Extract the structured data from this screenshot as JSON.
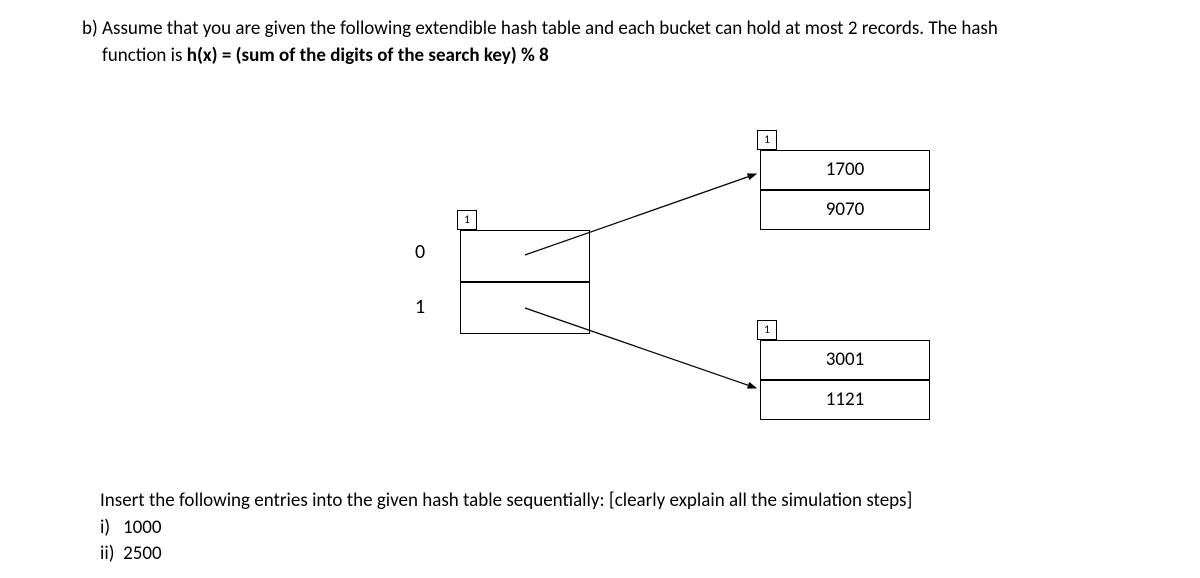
{
  "problem": {
    "prefix": "b)",
    "line1": "Assume that you are given the following extendible hash table and each bucket can hold at most 2 records. The hash",
    "line2_pre": "function is ",
    "line2_bold": "h(x) = (sum of the digits of the search key) % 8"
  },
  "diagram": {
    "global_depth": "1",
    "dir_labels": [
      "0",
      "1"
    ],
    "bucket_a": {
      "local_depth": "1",
      "records": [
        "1700",
        "9070"
      ]
    },
    "bucket_b": {
      "local_depth": "1",
      "records": [
        "3001",
        "1121"
      ]
    }
  },
  "instructions": {
    "insert_text": "Insert the following entries into the given hash table sequentially: [clearly explain all the simulation steps]",
    "items": [
      {
        "label": "i)",
        "value": "1000"
      },
      {
        "label": "ii)",
        "value": "2500"
      }
    ]
  }
}
